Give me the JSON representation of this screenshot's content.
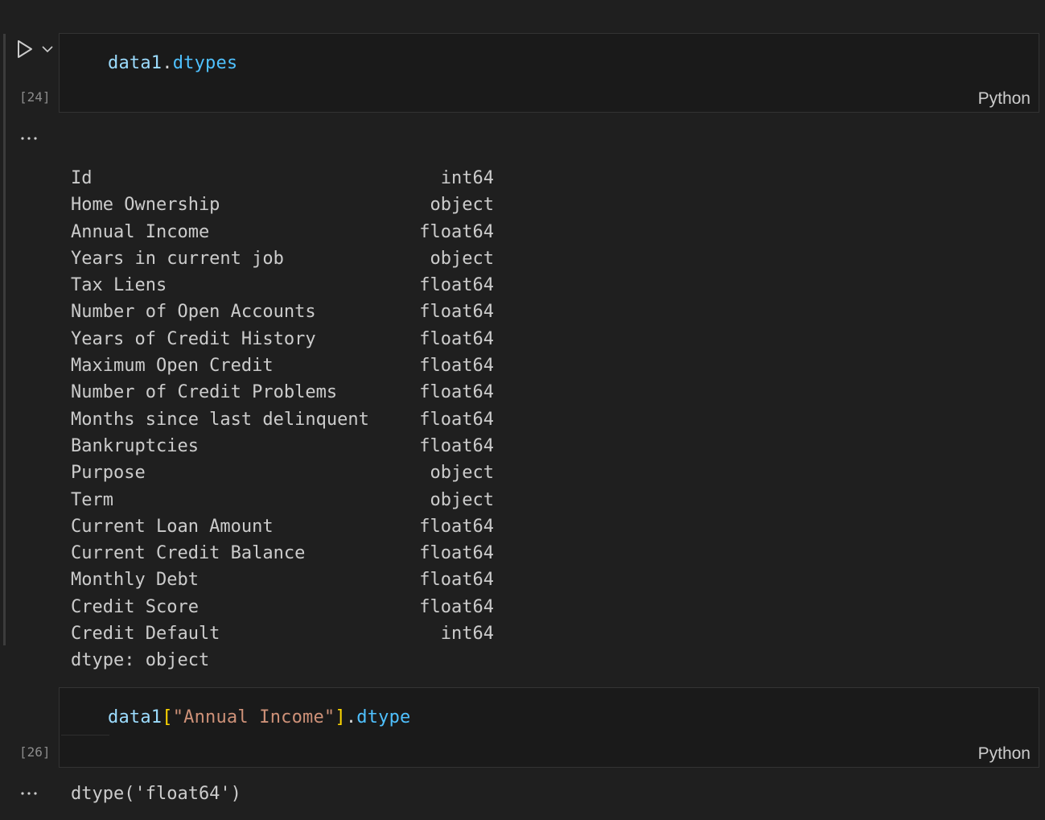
{
  "cells": [
    {
      "execution_count": "[24]",
      "language": "Python",
      "code": {
        "var": "data1",
        "dot": ".",
        "attr": "dtypes"
      },
      "output": {
        "rows": [
          {
            "name": "Id",
            "type": "int64"
          },
          {
            "name": "Home Ownership",
            "type": "object"
          },
          {
            "name": "Annual Income",
            "type": "float64"
          },
          {
            "name": "Years in current job",
            "type": "object"
          },
          {
            "name": "Tax Liens",
            "type": "float64"
          },
          {
            "name": "Number of Open Accounts",
            "type": "float64"
          },
          {
            "name": "Years of Credit History",
            "type": "float64"
          },
          {
            "name": "Maximum Open Credit",
            "type": "float64"
          },
          {
            "name": "Number of Credit Problems",
            "type": "float64"
          },
          {
            "name": "Months since last delinquent",
            "type": "float64"
          },
          {
            "name": "Bankruptcies",
            "type": "float64"
          },
          {
            "name": "Purpose",
            "type": "object"
          },
          {
            "name": "Term",
            "type": "object"
          },
          {
            "name": "Current Loan Amount",
            "type": "float64"
          },
          {
            "name": "Current Credit Balance",
            "type": "float64"
          },
          {
            "name": "Monthly Debt",
            "type": "float64"
          },
          {
            "name": "Credit Score",
            "type": "float64"
          },
          {
            "name": "Credit Default",
            "type": "int64"
          }
        ],
        "footer": "dtype: object"
      }
    },
    {
      "execution_count": "[26]",
      "language": "Python",
      "code": {
        "var": "data1",
        "open_bracket": "[",
        "string": "\"Annual Income\"",
        "close_bracket": "]",
        "dot": ".",
        "attr": "dtype"
      },
      "output": {
        "text": "dtype('float64')"
      }
    }
  ],
  "icons": {
    "run": "run-cell-icon",
    "chevron": "chevron-down-icon",
    "more": "more-horizontal-icon"
  },
  "colors": {
    "background": "#1f1f1f",
    "cell_background": "#1a1a1a",
    "variable": "#9cdcfe",
    "attribute": "#4fc1ff",
    "string": "#ce9178",
    "bracket": "#ffd700",
    "output_text": "#cccccc"
  }
}
